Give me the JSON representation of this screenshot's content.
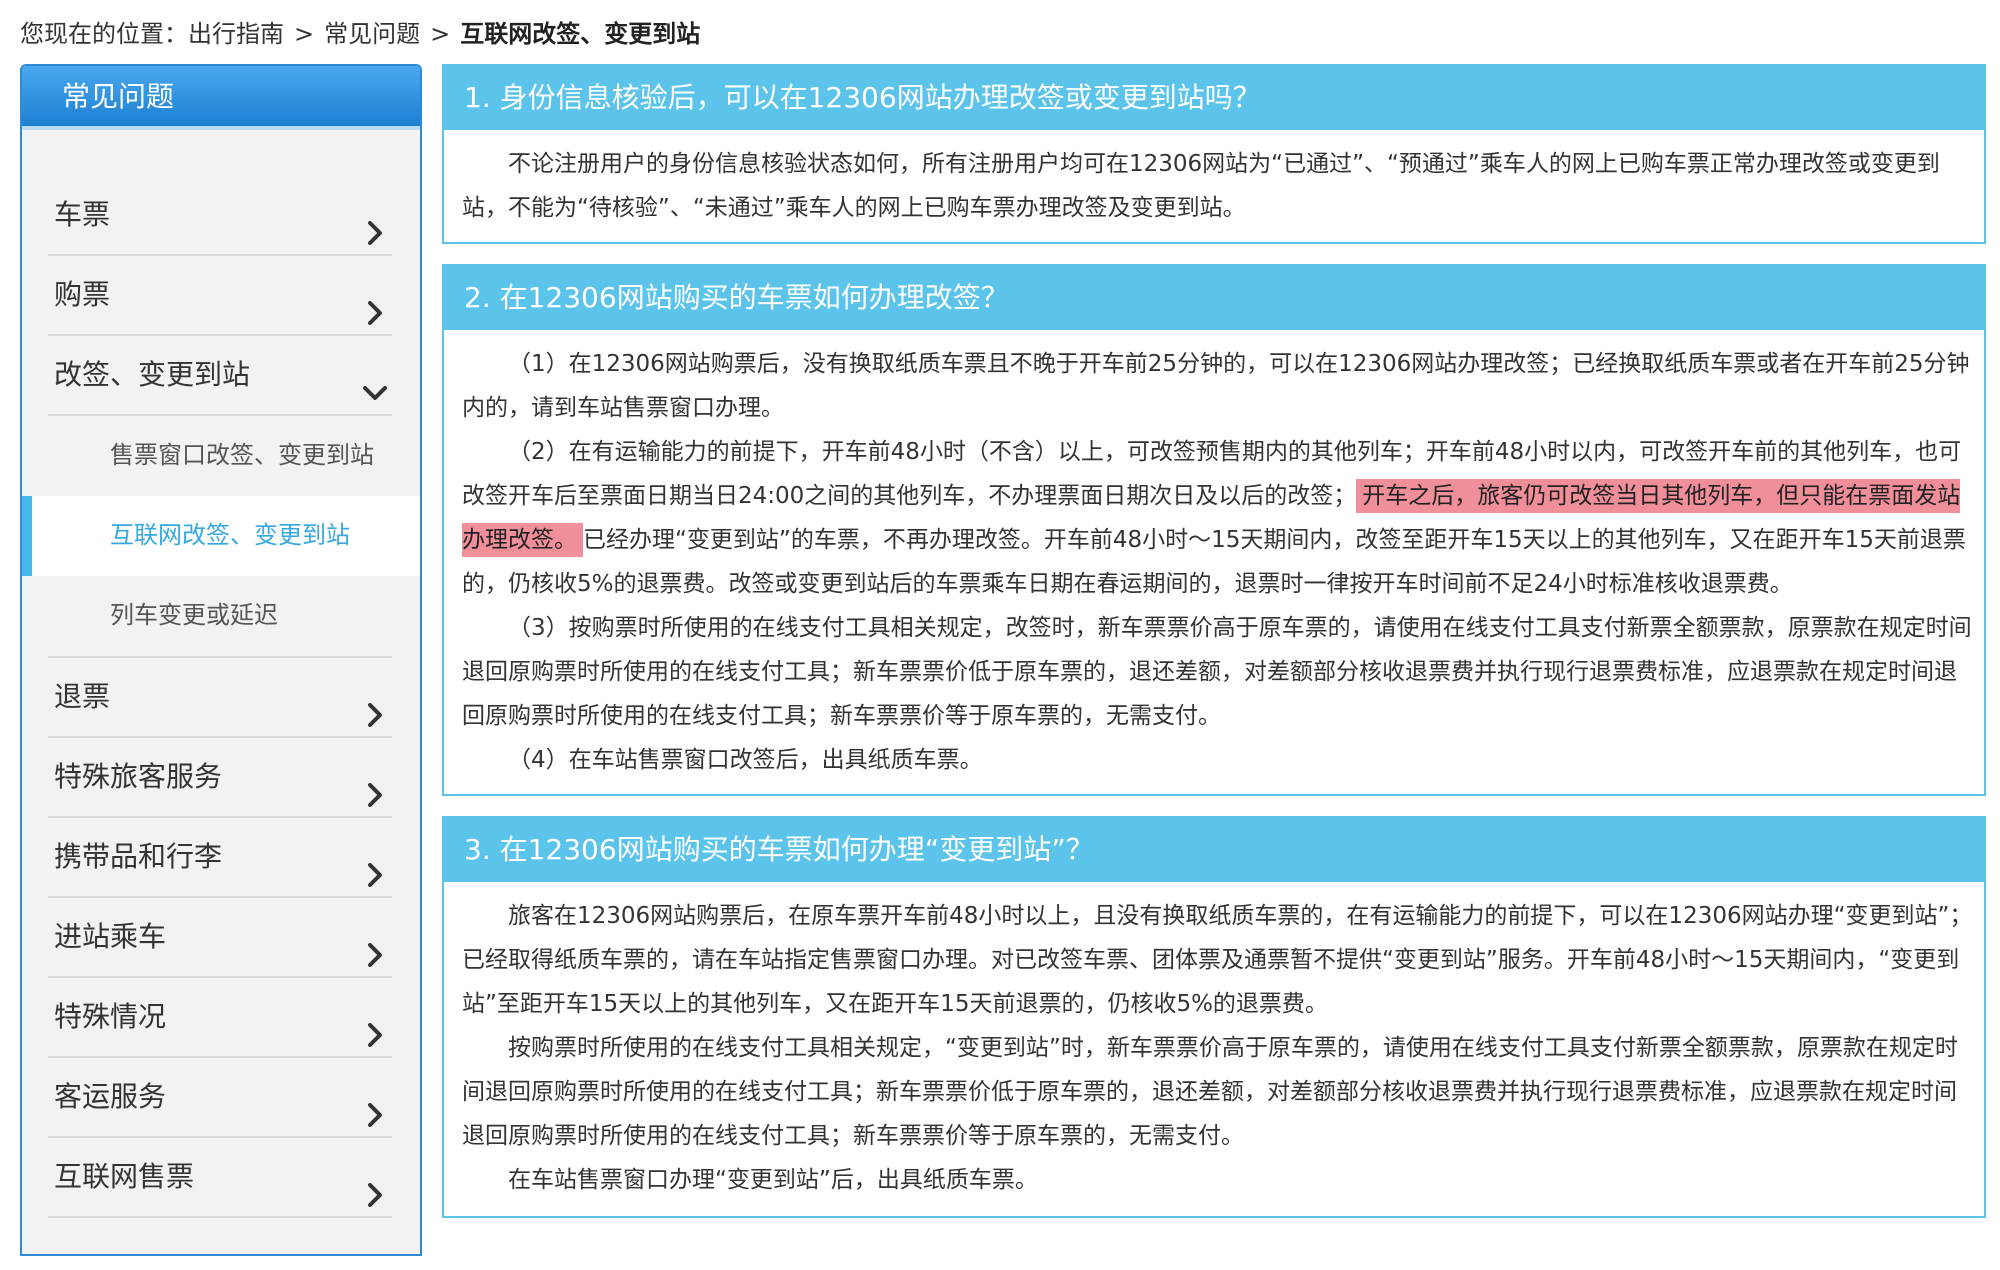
{
  "breadcrumb": {
    "prefix": "您现在的位置：",
    "items": [
      "出行指南",
      "常见问题",
      "互联网改签、变更到站"
    ],
    "separator": ">"
  },
  "sidebar": {
    "title": "常见问题",
    "items": [
      {
        "label": "车票",
        "icon": "chevron-right-icon"
      },
      {
        "label": "购票",
        "icon": "chevron-right-icon"
      },
      {
        "label": "改签、变更到站",
        "icon": "chevron-down-icon",
        "expanded": true,
        "children": [
          {
            "label": "售票窗口改签、变更到站",
            "active": false
          },
          {
            "label": "互联网改签、变更到站",
            "active": true
          },
          {
            "label": "列车变更或延迟",
            "active": false
          }
        ]
      },
      {
        "label": "退票",
        "icon": "chevron-right-icon"
      },
      {
        "label": "特殊旅客服务",
        "icon": "chevron-right-icon"
      },
      {
        "label": "携带品和行李",
        "icon": "chevron-right-icon"
      },
      {
        "label": "进站乘车",
        "icon": "chevron-right-icon"
      },
      {
        "label": "特殊情况",
        "icon": "chevron-right-icon"
      },
      {
        "label": "客运服务",
        "icon": "chevron-right-icon"
      },
      {
        "label": "互联网售票",
        "icon": "chevron-right-icon"
      }
    ]
  },
  "questions": [
    {
      "title": "1. 身份信息核验后，可以在12306网站办理改签或变更到站吗？",
      "paragraphs": [
        "不论注册用户的身份信息核验状态如何，所有注册用户均可在12306网站为“已通过”、“预通过”乘车人的网上已购车票正常办理改签或变更到站，不能为“待核验”、“未通过”乘车人的网上已购车票办理改签及变更到站。"
      ]
    },
    {
      "title": "2. 在12306网站购买的车票如何办理改签？",
      "p1": "（1）在12306网站购票后，没有换取纸质车票且不晚于开车前25分钟的，可以在12306网站办理改签；已经换取纸质车票或者在开车前25分钟内的，请到车站售票窗口办理。",
      "p2_before": "（2）在有运输能力的前提下，开车前48小时（不含）以上，可改签预售期内的其他列车；开车前48小时以内，可改签开车前的其他列车，也可改签开车后至票面日期当日24:00之间的其他列车，不办理票面日期次日及以后的改签；",
      "p2_highlight": "开车之后，旅客仍可改签当日其他列车，但只能在票面发站办理改签。",
      "p2_after": "已经办理“变更到站”的车票，不再办理改签。开车前48小时～15天期间内，改签至距开车15天以上的其他列车，又在距开车15天前退票的，仍核收5%的退票费。改签或变更到站后的车票乘车日期在春运期间的，退票时一律按开车时间前不足24小时标准核收退票费。",
      "p3": "（3）按购票时所使用的在线支付工具相关规定，改签时，新车票票价高于原车票的，请使用在线支付工具支付新票全额票款，原票款在规定时间退回原购票时所使用的在线支付工具；新车票票价低于原车票的，退还差额，对差额部分核收退票费并执行现行退票费标准，应退票款在规定时间退回原购票时所使用的在线支付工具；新车票票价等于原车票的，无需支付。",
      "p4": "（4）在车站售票窗口改签后，出具纸质车票。"
    },
    {
      "title": "3. 在12306网站购买的车票如何办理“变更到站”？",
      "paragraphs": [
        "旅客在12306网站购票后，在原车票开车前48小时以上，且没有换取纸质车票的，在有运输能力的前提下，可以在12306网站办理“变更到站”；已经取得纸质车票的，请在车站指定售票窗口办理。对已改签车票、团体票及通票暂不提供“变更到站”服务。开车前48小时～15天期间内，“变更到站”至距开车15天以上的其他列车，又在距开车15天前退票的，仍核收5%的退票费。",
        "按购票时所使用的在线支付工具相关规定，“变更到站”时，新车票票价高于原车票的，请使用在线支付工具支付新票全额票款，原票款在规定时间退回原购票时所使用的在线支付工具；新车票票价低于原车票的，退还差额，对差额部分核收退票费并执行现行退票费标准，应退票款在规定时间退回原购票时所使用的在线支付工具；新车票票价等于原车票的，无需支付。",
        "在车站售票窗口办理“变更到站”后，出具纸质车票。"
      ]
    }
  ],
  "colors": {
    "header_blue": "#1c7fd2",
    "title_bar": "#5cc4ea",
    "active_text": "#35a9df",
    "highlight": "#f08e99"
  }
}
